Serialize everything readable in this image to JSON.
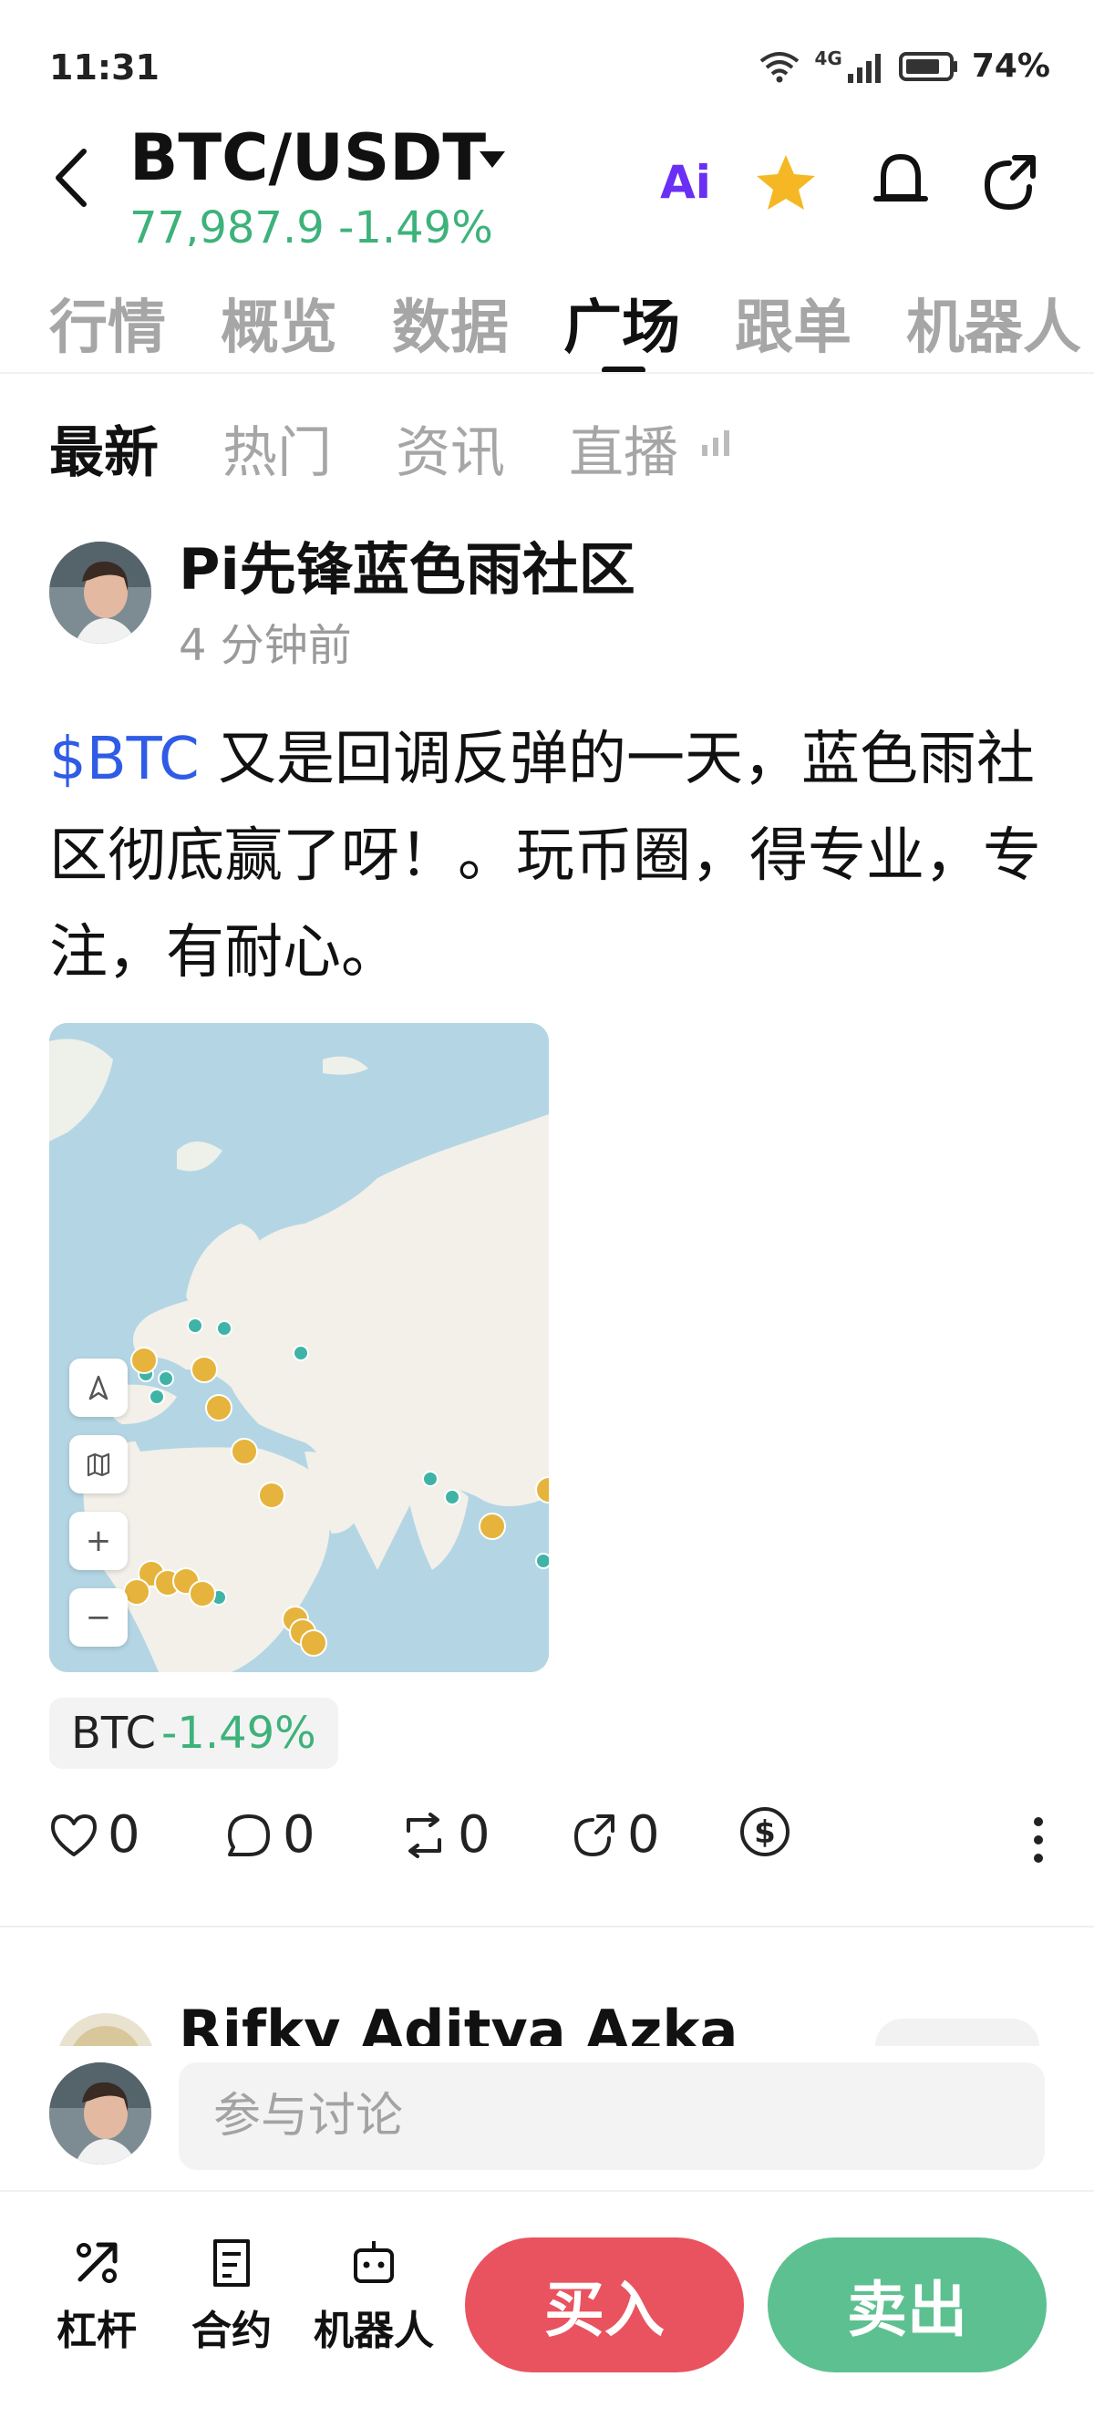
{
  "status_bar": {
    "time": "11:31",
    "network": "4G",
    "battery": "74%"
  },
  "header": {
    "pair": "BTC/USDT",
    "price_line": "77,987.9  -1.49%",
    "ai_label": "Ai",
    "accent_price_color": "#3db27a"
  },
  "main_tabs": [
    {
      "label": "行情"
    },
    {
      "label": "概览"
    },
    {
      "label": "数据"
    },
    {
      "label": "广场",
      "active": true
    },
    {
      "label": "跟单"
    },
    {
      "label": "机器人"
    }
  ],
  "sub_tabs": [
    {
      "label": "最新",
      "active": true
    },
    {
      "label": "热门"
    },
    {
      "label": "资讯"
    },
    {
      "label": "直播"
    }
  ],
  "post": {
    "author": "Pi先锋蓝色雨社区",
    "time": "4 分钟前",
    "ticker": "$BTC",
    "text": " 又是回调反弹的一天，蓝色雨社区彻底赢了呀！。玩币圈，得专业，专注，有耐心。",
    "map_controls": [
      "navigate",
      "map",
      "+",
      "−"
    ],
    "coin_tag": {
      "symbol": "BTC",
      "change": "-1.49%"
    },
    "actions": {
      "likes": "0",
      "comments": "0",
      "reposts": "0",
      "shares": "0"
    }
  },
  "next_post": {
    "author": "Rifky Aditya Azka"
  },
  "comment": {
    "placeholder": "参与讨论"
  },
  "bottom_bar": {
    "leverage": "杠杆",
    "contract": "合约",
    "bot": "机器人",
    "buy": "买入",
    "sell": "卖出",
    "buy_color": "#e9535f",
    "sell_color": "#5dc090"
  }
}
